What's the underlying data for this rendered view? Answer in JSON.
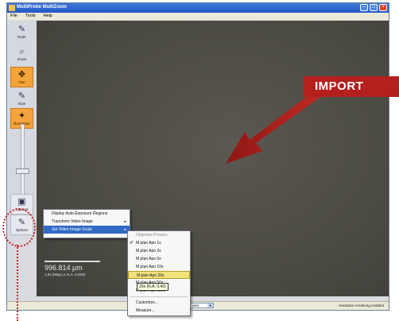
{
  "window": {
    "title": "MultiProbe MultiZoom"
  },
  "menubar": [
    "File",
    "Tools",
    "Help"
  ],
  "tools": [
    {
      "label": "Ruler",
      "icon": "ruler-icon",
      "glyph": "✎"
    },
    {
      "label": "Zoom",
      "icon": "zoom-icon",
      "glyph": "🔍"
    },
    {
      "label": "Pan",
      "icon": "pan-icon",
      "glyph": "✥"
    },
    {
      "label": "Note",
      "icon": "note-icon",
      "glyph": "✎"
    },
    {
      "label": "Illuminator",
      "icon": "illuminator-icon",
      "glyph": "✦"
    },
    {
      "label": "Capture",
      "icon": "capture-icon",
      "glyph": "▣"
    },
    {
      "label": "Options",
      "icon": "options-icon",
      "glyph": "✎"
    }
  ],
  "scale": {
    "value": "996.814 μm",
    "sub": "1.0x (Mag Lv, N.A. 0.025)"
  },
  "options_menu": [
    "Display Auto-Exposure Regions",
    "Transform Video Image",
    "Set Video Image Scale"
  ],
  "scale_menu": {
    "header": "Objective Presets:",
    "items": [
      "M plan Apo 1x",
      "M plan Apo 2x",
      "M plan Apo 5x",
      "M plan Apo 10x",
      "M plan Apo 20x",
      "M plan Apo 50x",
      "M plan Apo 100x"
    ],
    "extra": [
      "Customize...",
      "Measure..."
    ]
  },
  "tooltip": "20x (N.A. 0.42)",
  "status": {
    "combo": "0528857-43 (in use)",
    "right": "Hardware rendering enabled"
  },
  "annotation": {
    "banner": "IMPORT"
  },
  "colors": {
    "accent": "#f4a43a",
    "annotation": "#b3201e"
  }
}
